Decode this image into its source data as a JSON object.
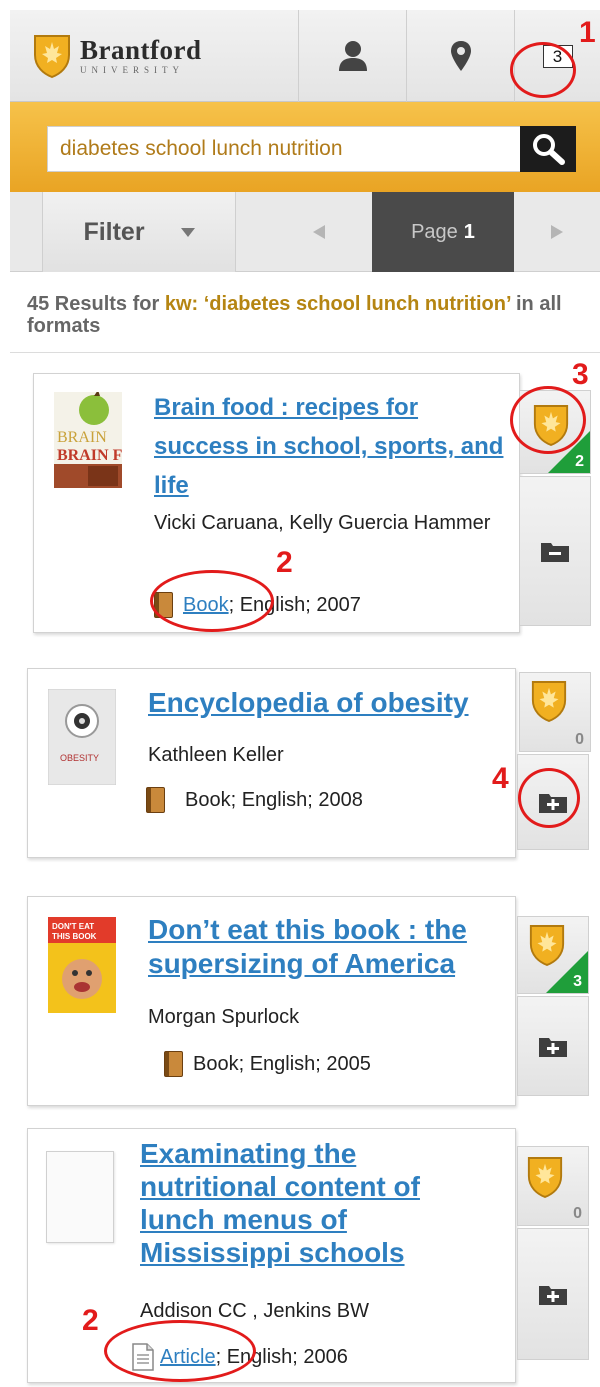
{
  "header": {
    "logo_main": "Brantford",
    "logo_sub": "UNIVERSITY",
    "cart_count": "3"
  },
  "search": {
    "value": "diabetes school lunch nutrition"
  },
  "pager": {
    "filter_label": "Filter",
    "page_label": "Page",
    "page_number": "1"
  },
  "summary": {
    "prefix": "45 Results for ",
    "kw_label": "kw:",
    "query": "‘diabetes school lunch nutrition’",
    "suffix": " in all formats"
  },
  "results": [
    {
      "title": "Brain food : recipes for success in school, sports, and life",
      "authors": "Vicki Caruana, Kelly Guercia Hammer",
      "format": "Book",
      "meta_rest": "; English; 2007",
      "holdings_count": "2",
      "action": "remove",
      "cover_text": "BRAIN FOOD"
    },
    {
      "title": "Encyclopedia of obesity",
      "authors": "Kathleen Keller",
      "format": "Book",
      "meta_rest": "; English; 2008",
      "holdings_count": "0",
      "action": "add",
      "cover_text": "OBESITY"
    },
    {
      "title": "Don’t eat this book : the supersizing of America",
      "authors": "Morgan Spurlock",
      "format": "Book",
      "meta_rest": "; English; 2005",
      "holdings_count": "3",
      "action": "add",
      "cover_text": "DON'T EAT THIS BOOK"
    },
    {
      "title": "Examinating the nutritional content of lunch menus of Mississippi schools",
      "authors": "Addison CC , Jenkins BW",
      "format": "Article",
      "meta_rest": "; English; 2006",
      "holdings_count": "0",
      "action": "add",
      "cover_text": ""
    }
  ],
  "annotations": [
    "1",
    "2",
    "3",
    "2",
    "4"
  ],
  "colors": {
    "accent_gold": "#e9a424",
    "link_blue": "#2e7fc0",
    "held_green": "#1f9e3a",
    "annotation_red": "#e21b1b"
  },
  "icons": {
    "logo": "shield-maple-leaf-icon",
    "user": "person-icon",
    "location": "map-pin-icon",
    "search": "magnifier-icon",
    "prev": "triangle-left-icon",
    "next": "triangle-right-icon",
    "book": "book-icon",
    "article": "document-icon",
    "held": "shield-maple-leaf-icon",
    "remove": "folder-minus-icon",
    "add": "folder-plus-icon"
  }
}
